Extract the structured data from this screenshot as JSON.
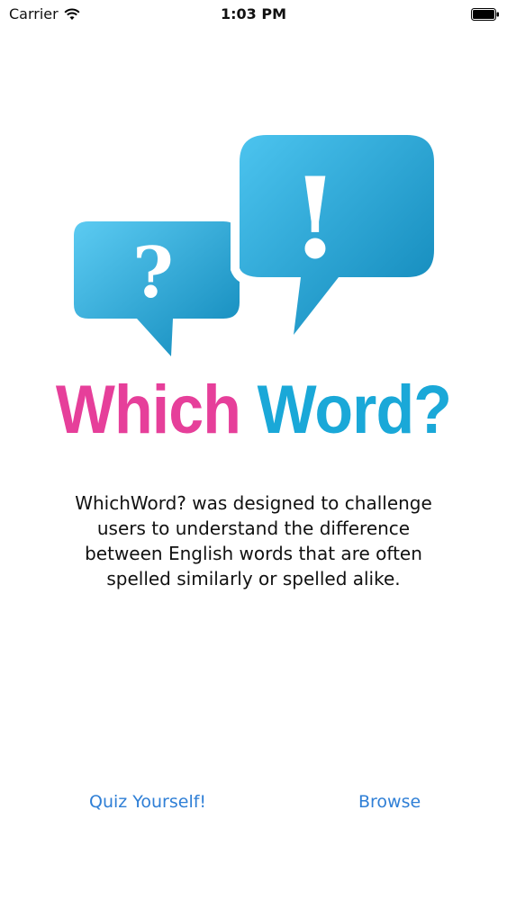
{
  "status_bar": {
    "carrier": "Carrier",
    "time": "1:03 PM",
    "icons": [
      "wifi-icon",
      "battery-icon"
    ]
  },
  "logo": {
    "title_part1": "Which",
    "title_part2": "Word?",
    "question_mark": "?",
    "exclamation_mark": "!",
    "colors": {
      "pink": "#e63f9a",
      "blue": "#1aa8d8",
      "bubble_light": "#5cc9f0",
      "bubble_dark": "#0f86b8"
    }
  },
  "description": "WhichWord? was designed to challenge users to understand the difference between English words that are often spelled similarly or spelled alike.",
  "buttons": {
    "quiz": "Quiz Yourself!",
    "browse": "Browse"
  },
  "accent_color": "#2f7fd6"
}
